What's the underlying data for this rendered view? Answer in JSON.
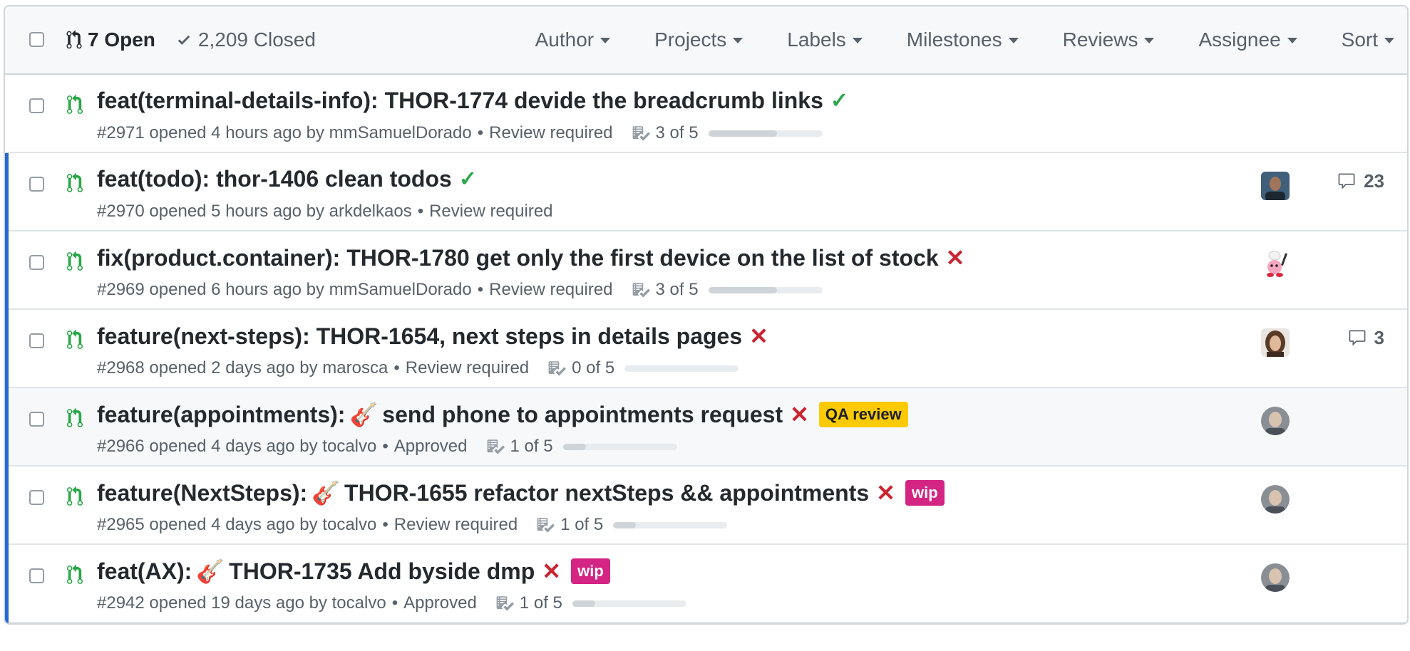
{
  "header": {
    "open_label": "7 Open",
    "closed_label": "2,209 Closed",
    "filters": [
      "Author",
      "Projects",
      "Labels",
      "Milestones",
      "Reviews",
      "Assignee",
      "Sort"
    ]
  },
  "colors": {
    "open_green": "#28a745",
    "fail_red": "#cb2431",
    "unread_blue": "#2468d6",
    "label_qa": "#fbca04",
    "label_wip": "#d42484"
  },
  "pull_requests": [
    {
      "title": "feat(terminal-details-info): THOR-1774 devide the breadcrumb links",
      "status": "✓",
      "number": "#2971",
      "opened": "opened 4 hours ago by",
      "author": "mmSamuelDorado",
      "bullet": "•",
      "review": "Review required",
      "tasks": "3 of 5",
      "progress": 0.6
    },
    {
      "title": "feat(todo): thor-1406 clean todos",
      "status": "✓",
      "number": "#2970",
      "opened": "opened 5 hours ago by",
      "author": "arkdelkaos",
      "bullet": "•",
      "review": "Review required",
      "comments": "23"
    },
    {
      "title": "fix(product.container): THOR-1780 get only the first device on the list of stock",
      "status": "✕",
      "number": "#2969",
      "opened": "opened 6 hours ago by",
      "author": "mmSamuelDorado",
      "bullet": "•",
      "review": "Review required",
      "tasks": "3 of 5",
      "progress": 0.6
    },
    {
      "title": "feature(next-steps): THOR-1654, next steps in details pages",
      "status": "✕",
      "number": "#2968",
      "opened": "opened 2 days ago by",
      "author": "marosca",
      "bullet": "•",
      "review": "Review required",
      "tasks": "0 of 5",
      "progress": 0.0,
      "comments": "3"
    },
    {
      "title_prefix": "feature(appointments):",
      "title": "send phone to appointments request",
      "emoji": "🎸",
      "status": "✕",
      "label": "QA review",
      "number": "#2966",
      "opened": "opened 4 days ago by",
      "author": "tocalvo",
      "bullet": "•",
      "review": "Approved",
      "tasks": "1 of 5",
      "progress": 0.2
    },
    {
      "title_prefix": "feature(NextSteps):",
      "title": "THOR-1655 refactor nextSteps && appointments",
      "emoji": "🎸",
      "status": "✕",
      "label": "wip",
      "number": "#2965",
      "opened": "opened 4 days ago by",
      "author": "tocalvo",
      "bullet": "•",
      "review": "Review required",
      "tasks": "1 of 5",
      "progress": 0.2
    },
    {
      "title_prefix": "feat(AX):",
      "title": "THOR-1735 Add byside dmp",
      "emoji": "🎸",
      "status": "✕",
      "label": "wip",
      "number": "#2942",
      "opened": "opened 19 days ago by",
      "author": "tocalvo",
      "bullet": "•",
      "review": "Approved",
      "tasks": "1 of 5",
      "progress": 0.2
    }
  ]
}
